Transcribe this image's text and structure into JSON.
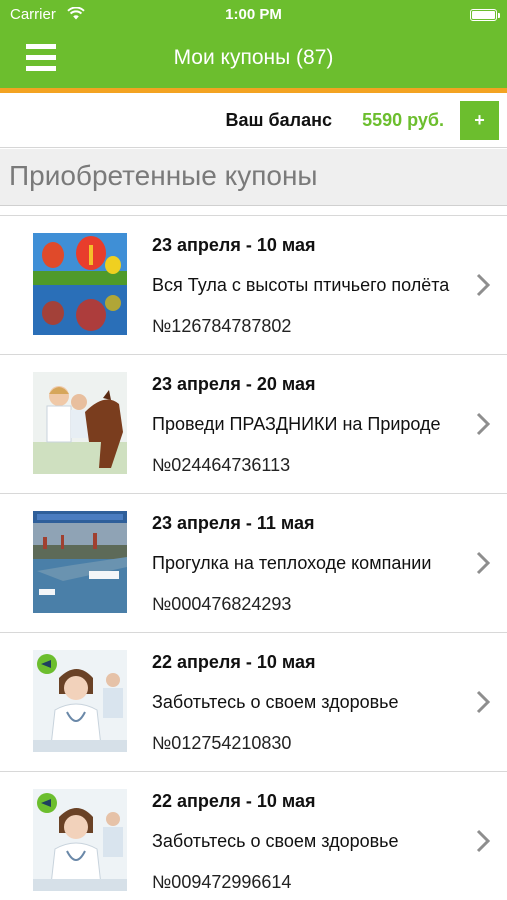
{
  "status_bar": {
    "carrier": "Carrier",
    "time": "1:00 PM"
  },
  "nav": {
    "title": "Мои купоны (87)",
    "menu_icon": "hamburger-menu-icon"
  },
  "balance": {
    "label": "Ваш баланс",
    "value": "5590 руб.",
    "add_label": "+"
  },
  "section": {
    "title": "Приобретенные купоны"
  },
  "colors": {
    "brand_green": "#6cbe2e",
    "accent_orange": "#f3a322"
  },
  "coupons": [
    {
      "dates": "23 апреля - 10 мая",
      "title": "Вся Тула с высоты птичьего полёта",
      "number": "№126784787802",
      "thumbnail": "hot-air-balloons-image"
    },
    {
      "dates": "23 апреля - 20 мая",
      "title": "Проведи ПРАЗДНИКИ на Природе",
      "number": "№024464736113",
      "thumbnail": "family-on-horse-image"
    },
    {
      "dates": "23 апреля - 11 мая",
      "title": "Прогулка на теплоходе компании",
      "number": "№000476824293",
      "thumbnail": "river-cruise-image"
    },
    {
      "dates": "22 апреля - 10 мая",
      "title": "Заботьтесь о своем здоровье",
      "number": "№012754210830",
      "thumbnail": "doctor-image"
    },
    {
      "dates": "22 апреля - 10 мая",
      "title": "Заботьтесь о своем здоровье",
      "number": "№009472996614",
      "thumbnail": "doctor-image"
    }
  ]
}
